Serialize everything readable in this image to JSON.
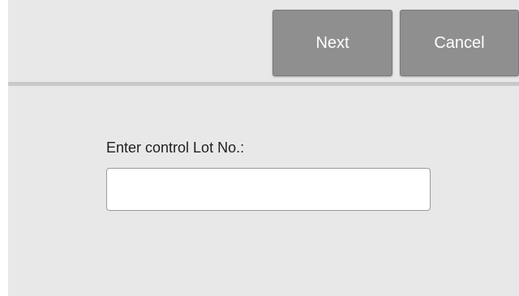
{
  "toolbar": {
    "next_label": "Next",
    "cancel_label": "Cancel"
  },
  "form": {
    "lot_label": "Enter control Lot No.:",
    "lot_value": "",
    "lot_placeholder": ""
  }
}
